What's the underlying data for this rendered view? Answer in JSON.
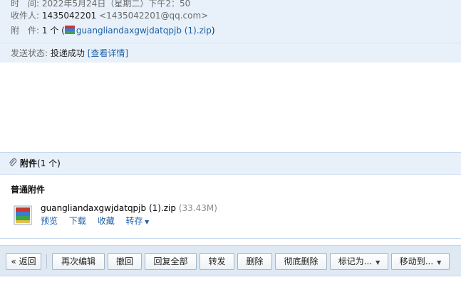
{
  "header": {
    "time_label": "时　间:",
    "time_value": "2022年5月24日（星期二）下午2：50",
    "to_label": "收件人:",
    "to_name": "1435042201",
    "to_email": "<1435042201@qq.com>",
    "att_label": "附　件:",
    "att_count": "1 个 (",
    "att_file": "guangliandaxgwjdatqpjb (1).zip",
    "att_close": ")",
    "status_label": "发送状态:",
    "status_value": "投递成功",
    "status_link": "[查看详情]"
  },
  "attachments": {
    "title": "附件",
    "count": "(1 个)",
    "section": "普通附件",
    "file_name": "guangliandaxgwjdatqpjb (1).zip",
    "file_size": "(33.43M)",
    "actions": {
      "preview": "预览",
      "download": "下载",
      "collect": "收藏",
      "forward": "转存"
    }
  },
  "toolbar": {
    "back": "« 返回",
    "reedit": "再次编辑",
    "recall": "撤回",
    "reply_all": "回复全部",
    "forward": "转发",
    "delete": "删除",
    "delete_forever": "彻底删除",
    "mark_as": "标记为...",
    "move_to": "移动到..."
  },
  "colors": {
    "accent_link": "#1c5fa8",
    "panel_bg": "#e8f1fa",
    "toolbar_bg": "#dfe9f4"
  }
}
